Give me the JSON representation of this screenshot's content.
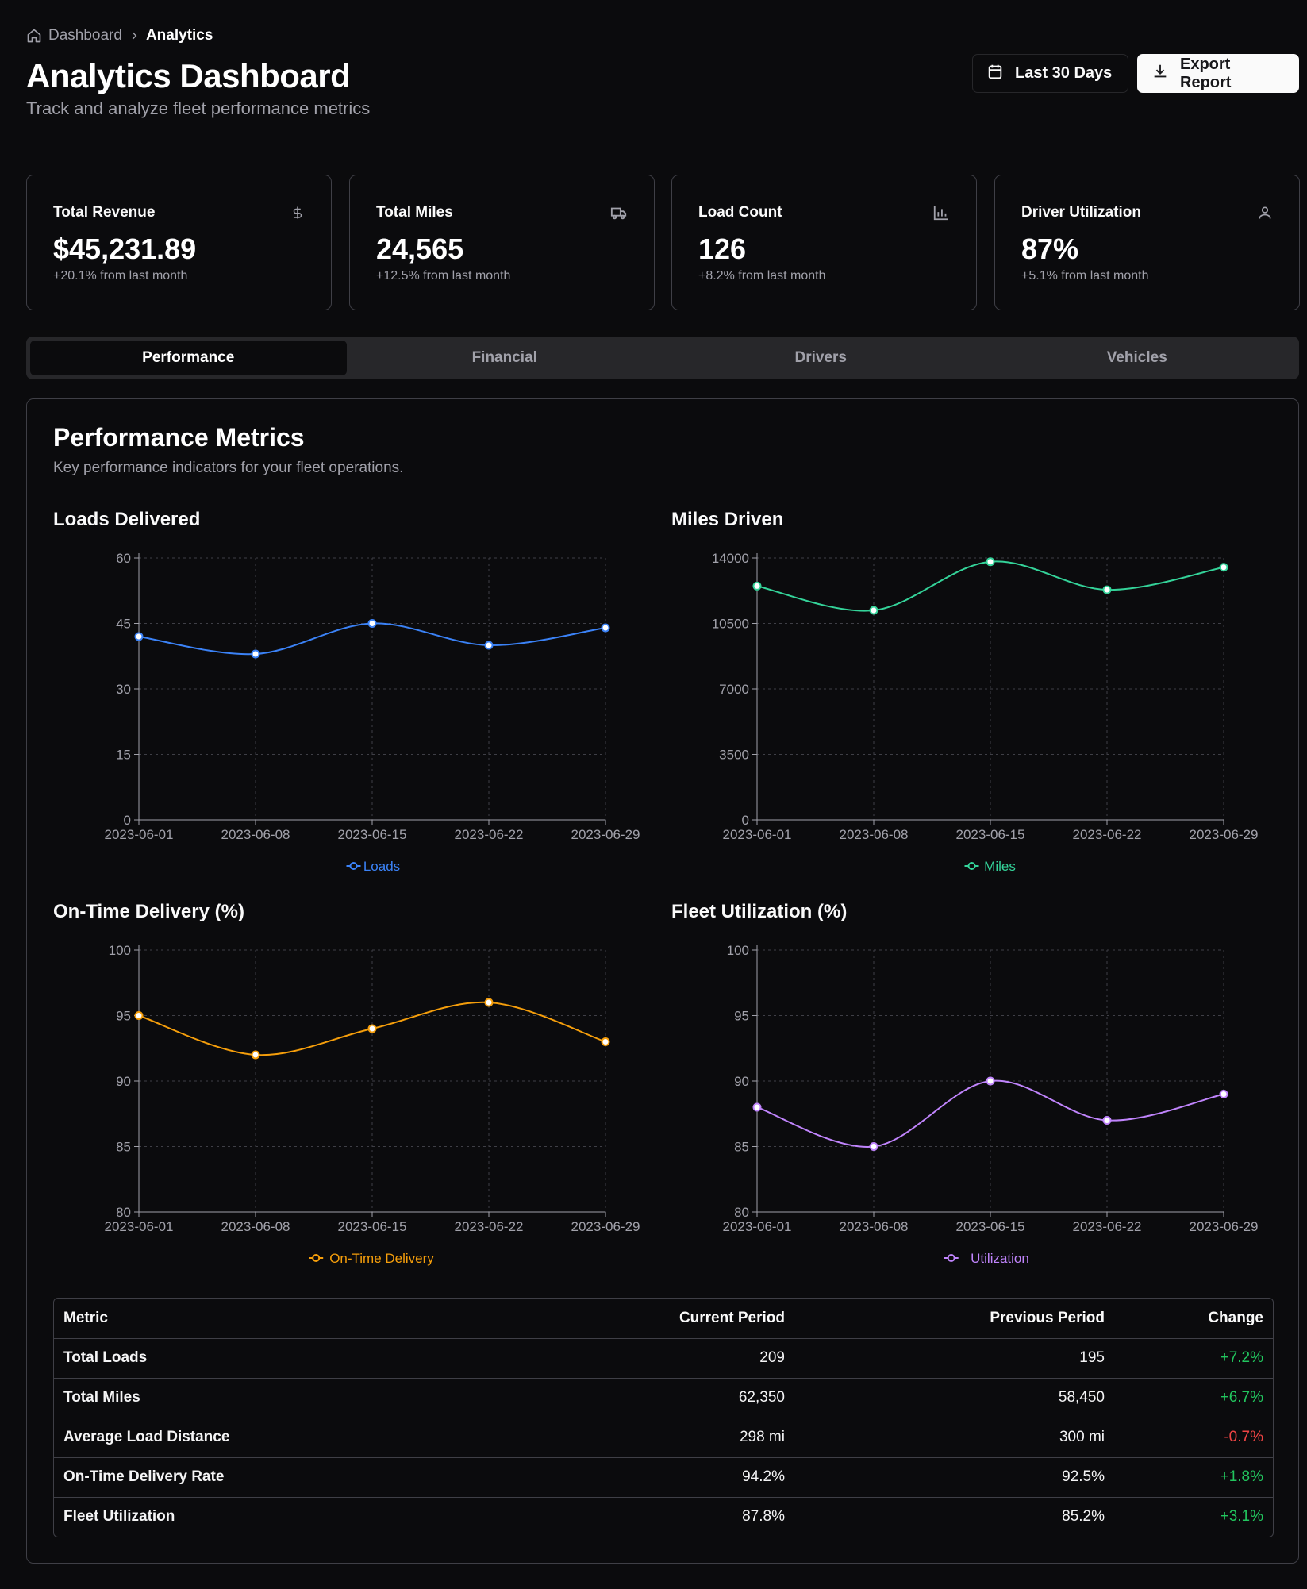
{
  "breadcrumb": {
    "home_icon": "home-icon",
    "parent": "Dashboard",
    "separator_icon": "chevron-right-icon",
    "current": "Analytics"
  },
  "header": {
    "title": "Analytics Dashboard",
    "subtitle": "Track and analyze fleet performance metrics",
    "date_range": {
      "icon": "calendar-icon",
      "label": "Last 30 Days"
    },
    "export": {
      "icon": "download-icon",
      "label": "Export Report"
    }
  },
  "kpis": [
    {
      "label": "Total Revenue",
      "value": "$45,231.89",
      "delta": "+20.1% from last month",
      "icon": "dollar-icon"
    },
    {
      "label": "Total Miles",
      "value": "24,565",
      "delta": "+12.5% from last month",
      "icon": "truck-icon"
    },
    {
      "label": "Load Count",
      "value": "126",
      "delta": "+8.2% from last month",
      "icon": "bar-chart-icon"
    },
    {
      "label": "Driver Utilization",
      "value": "87%",
      "delta": "+5.1% from last month",
      "icon": "user-icon"
    }
  ],
  "tabs": [
    {
      "label": "Performance",
      "active": true
    },
    {
      "label": "Financial",
      "active": false
    },
    {
      "label": "Drivers",
      "active": false
    },
    {
      "label": "Vehicles",
      "active": false
    }
  ],
  "panel": {
    "title": "Performance Metrics",
    "description": "Key performance indicators for your fleet operations."
  },
  "chart_data": [
    {
      "type": "line",
      "title": "Loads Delivered",
      "x": [
        "2023-06-01",
        "2023-06-08",
        "2023-06-15",
        "2023-06-22",
        "2023-06-29"
      ],
      "series": [
        {
          "name": "Loads",
          "values": [
            42,
            38,
            45,
            40,
            44
          ],
          "color": "#3b82f6"
        }
      ],
      "yticks": [
        0,
        15,
        30,
        45,
        60
      ],
      "ylim": [
        0,
        60
      ],
      "grid": true,
      "legend": "bottom"
    },
    {
      "type": "line",
      "title": "Miles Driven",
      "x": [
        "2023-06-01",
        "2023-06-08",
        "2023-06-15",
        "2023-06-22",
        "2023-06-29"
      ],
      "series": [
        {
          "name": "Miles",
          "values": [
            12500,
            11200,
            13800,
            12300,
            13500
          ],
          "color": "#34d399"
        }
      ],
      "yticks": [
        0,
        3500,
        7000,
        10500,
        14000
      ],
      "ylim": [
        0,
        14000
      ],
      "grid": true,
      "legend": "bottom"
    },
    {
      "type": "line",
      "title": "On-Time Delivery (%)",
      "x": [
        "2023-06-01",
        "2023-06-08",
        "2023-06-15",
        "2023-06-22",
        "2023-06-29"
      ],
      "series": [
        {
          "name": "On-Time Delivery",
          "values": [
            95,
            92,
            94,
            96,
            93
          ],
          "color": "#f59e0b"
        }
      ],
      "yticks": [
        80,
        85,
        90,
        95,
        100
      ],
      "ylim": [
        80,
        100
      ],
      "grid": true,
      "legend": "bottom"
    },
    {
      "type": "line",
      "title": "Fleet Utilization (%)",
      "x": [
        "2023-06-01",
        "2023-06-08",
        "2023-06-15",
        "2023-06-22",
        "2023-06-29"
      ],
      "series": [
        {
          "name": "Utilization",
          "values": [
            88,
            85,
            90,
            87,
            89
          ],
          "color": "#c084fc"
        }
      ],
      "yticks": [
        80,
        85,
        90,
        95,
        100
      ],
      "ylim": [
        80,
        100
      ],
      "grid": true,
      "legend": "bottom"
    }
  ],
  "table": {
    "headers": [
      "Metric",
      "Current Period",
      "Previous Period",
      "Change"
    ],
    "rows": [
      {
        "metric": "Total Loads",
        "current": "209",
        "previous": "195",
        "change": "+7.2%",
        "positive": true
      },
      {
        "metric": "Total Miles",
        "current": "62,350",
        "previous": "58,450",
        "change": "+6.7%",
        "positive": true
      },
      {
        "metric": "Average Load Distance",
        "current": "298 mi",
        "previous": "300 mi",
        "change": "-0.7%",
        "positive": false
      },
      {
        "metric": "On-Time Delivery Rate",
        "current": "94.2%",
        "previous": "92.5%",
        "change": "+1.8%",
        "positive": true
      },
      {
        "metric": "Fleet Utilization",
        "current": "87.8%",
        "previous": "85.2%",
        "change": "+3.1%",
        "positive": true
      }
    ]
  },
  "colors": {
    "background": "#0b0b0d",
    "border": "#3f3f46",
    "positive": "#22c55e",
    "negative": "#ef4444"
  }
}
